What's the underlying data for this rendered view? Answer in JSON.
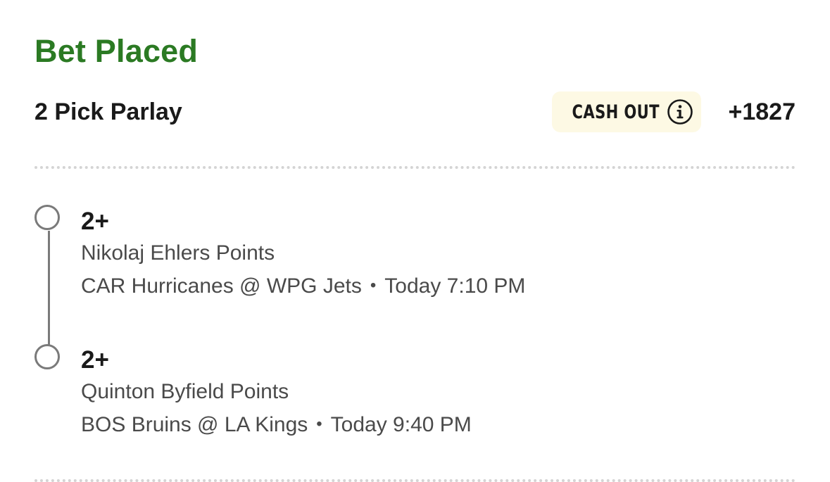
{
  "status_title": "Bet Placed",
  "bet": {
    "type": "2 Pick Parlay",
    "cashout_label": "CASH OUT",
    "odds": "+1827"
  },
  "legs": [
    {
      "line": "2+",
      "market": "Nikolaj Ehlers Points",
      "matchup": "CAR Hurricanes @ WPG Jets",
      "separator": "•",
      "time": "Today 7:10 PM"
    },
    {
      "line": "2+",
      "market": "Quinton Byfield Points",
      "matchup": "BOS Bruins @ LA Kings",
      "separator": "•",
      "time": "Today 9:40 PM"
    }
  ],
  "colors": {
    "status_green": "#2b7a23",
    "cashout_bg": "#fdf9e4",
    "timeline_gray": "#7a7a7a"
  },
  "icons": {
    "cashout_info": "info-circle-icon",
    "leg_marker": "circle-outline-icon"
  }
}
